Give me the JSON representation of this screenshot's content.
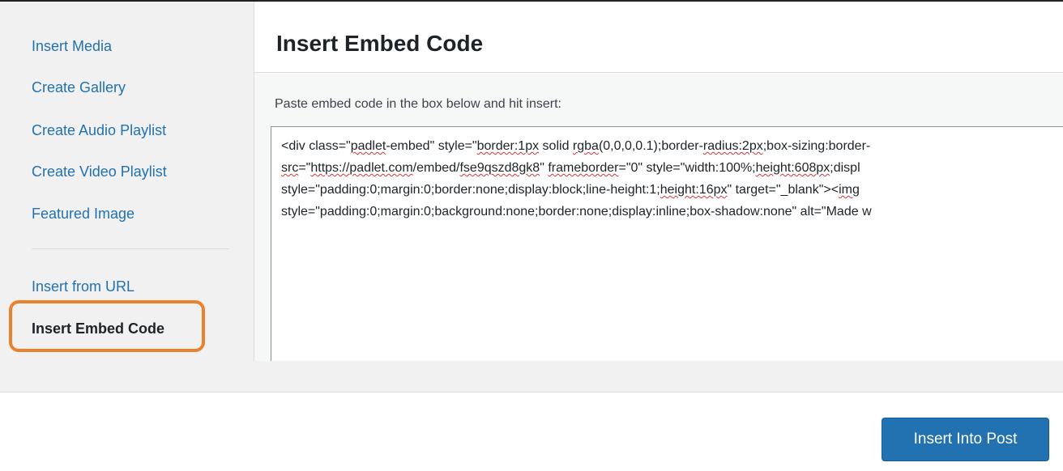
{
  "sidebar": {
    "items": [
      {
        "label": "Insert Media"
      },
      {
        "label": "Create Gallery"
      },
      {
        "label": "Create Audio Playlist"
      },
      {
        "label": "Create Video Playlist"
      },
      {
        "label": "Featured Image"
      },
      {
        "label": "Insert from URL"
      },
      {
        "label": "Insert Embed Code",
        "active": true
      }
    ]
  },
  "main": {
    "title": "Insert Embed Code",
    "instructions": "Paste embed code in the box below and hit insert:",
    "embed_code": {
      "line1": {
        "a": "<div class=\"",
        "b": "padlet",
        "c": "-embed\" style=\"",
        "d": "border:1px",
        "e": " solid ",
        "f": "rgba",
        "g": "(0,0,0,0.1);border-",
        "h": "radius:2px",
        "i": ";box-sizing:border-"
      },
      "line2": {
        "a": "src",
        "b": "=\"",
        "c": "https://padlet.com",
        "d": "/embed/",
        "e": "fse9qszd8gk8",
        "f": "\" ",
        "g": "frameborder",
        "h": "=\"0\" style=\"width:100%;",
        "i": "height:608px",
        "j": ";displ"
      },
      "line3": {
        "a": "style=\"padding:0;margin:0;border:none;display:block;line-height:1;",
        "b": "height:16px",
        "c": "\" target=\"_blank\"><",
        "d": "img"
      },
      "line4": "style=\"padding:0;margin:0;background:none;border:none;display:inline;box-shadow:none\" alt=\"Made w"
    }
  },
  "footer": {
    "button_label": "Insert Into Post"
  },
  "colors": {
    "link": "#2271b1",
    "button": "#2271b1",
    "highlight": "#e8822e"
  }
}
